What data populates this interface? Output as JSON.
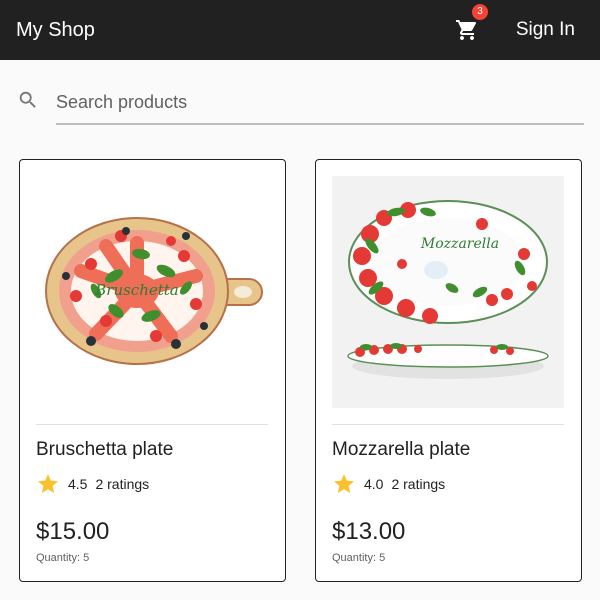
{
  "appbar": {
    "title": "My Shop",
    "cart_count": "3",
    "sign_in_label": "Sign In",
    "background": "#212121",
    "badge_color": "#f44336"
  },
  "search": {
    "placeholder": "Search products",
    "value": ""
  },
  "products": [
    {
      "name": "Bruschetta plate",
      "rating": "4.5",
      "ratings_count": "2 ratings",
      "price": "$15.00",
      "quantity": "Quantity: 5",
      "image_label": "Bruschetta"
    },
    {
      "name": "Mozzarella plate",
      "rating": "4.0",
      "ratings_count": "2 ratings",
      "price": "$13.00",
      "quantity": "Quantity: 5",
      "image_label": "Mozzarella"
    }
  ],
  "icons": {
    "cart": "cart-icon",
    "search": "search-icon",
    "star": "star-icon"
  },
  "colors": {
    "star": "#fbc02d",
    "card_border": "#212121",
    "tomato": "#e53935",
    "leaf": "#3f8f2e"
  }
}
